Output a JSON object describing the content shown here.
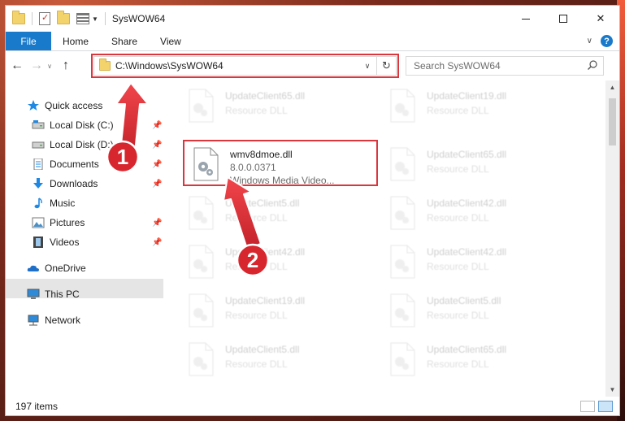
{
  "window": {
    "title": "SysWOW64"
  },
  "ribbon": {
    "tabs": [
      "File",
      "Home",
      "Share",
      "View"
    ]
  },
  "navigation": {
    "address": "C:\\Windows\\SysWOW64",
    "search_placeholder": "Search SysWOW64"
  },
  "sidebar": {
    "items": [
      {
        "label": "Quick access",
        "icon": "star-icon"
      },
      {
        "label": "Local Disk (C:)",
        "icon": "drive-icon"
      },
      {
        "label": "Local Disk (D:)",
        "icon": "drive-icon"
      },
      {
        "label": "Documents",
        "icon": "documents-icon"
      },
      {
        "label": "Downloads",
        "icon": "download-icon"
      },
      {
        "label": "Music",
        "icon": "music-icon"
      },
      {
        "label": "Pictures",
        "icon": "pictures-icon"
      },
      {
        "label": "Videos",
        "icon": "videos-icon"
      },
      {
        "label": "OneDrive",
        "icon": "cloud-icon"
      },
      {
        "label": "This PC",
        "icon": "computer-icon"
      },
      {
        "label": "Network",
        "icon": "network-icon"
      }
    ]
  },
  "files": [
    {
      "name": "UpdateClient65.dll",
      "type": "Resource DLL"
    },
    {
      "name": "UpdateClient19.dll",
      "type": "Resource DLL"
    },
    {
      "name": "wmv8dmoe.dll",
      "version": "8.0.0.0371",
      "description": "Windows Media Video..."
    },
    {
      "name": "UpdateClient65.dll",
      "type": "Resource DLL"
    },
    {
      "name": "UpdateClient5.dll",
      "type": "Resource DLL"
    },
    {
      "name": "UpdateClient42.dll",
      "type": "Resource DLL"
    },
    {
      "name": "UpdateClient42.dll",
      "type": "Resource DLL"
    },
    {
      "name": "UpdateClient42.dll",
      "type": "Resource DLL"
    },
    {
      "name": "UpdateClient19.dll",
      "type": "Resource DLL"
    },
    {
      "name": "UpdateClient5.dll",
      "type": "Resource DLL"
    },
    {
      "name": "UpdateClient5.dll",
      "type": "Resource DLL"
    },
    {
      "name": "UpdateClient65.dll",
      "type": "Resource DLL"
    }
  ],
  "status": {
    "item_count": "197 items"
  },
  "annotations": {
    "step1": "1",
    "step2": "2"
  },
  "colors": {
    "accent": "#1979ca",
    "highlight_red": "#d9363e"
  }
}
